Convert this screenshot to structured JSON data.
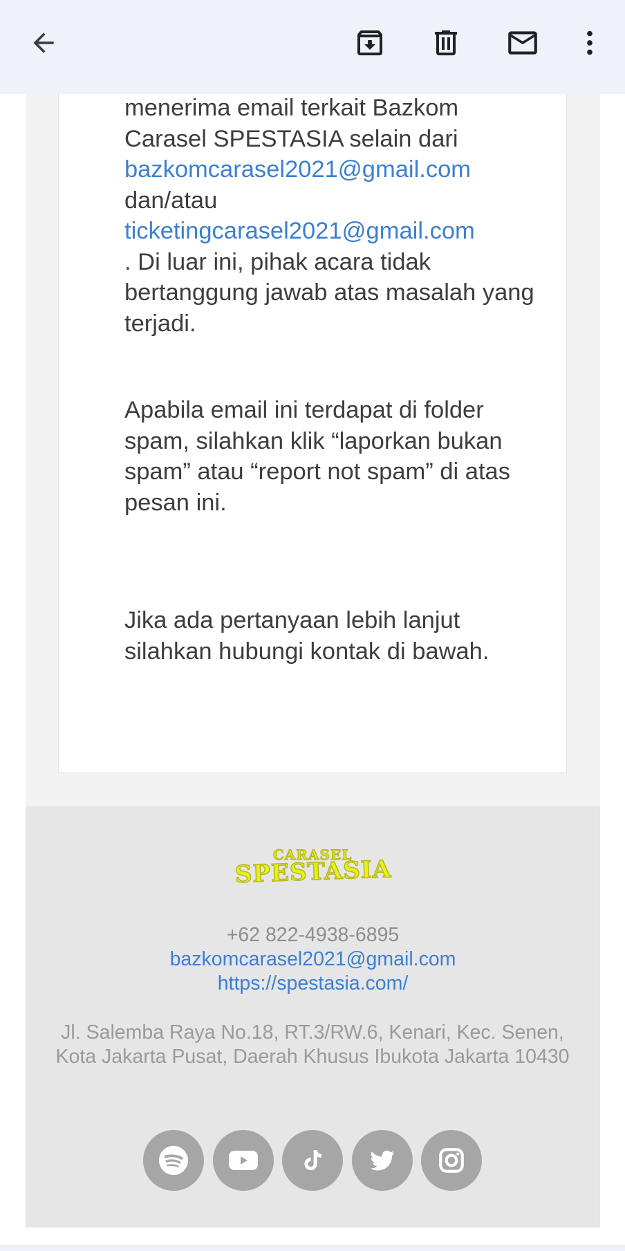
{
  "toolbar": {
    "back_icon": "arrow-left-icon",
    "archive_icon": "archive-icon",
    "delete_icon": "trash-icon",
    "mark_unread_icon": "mail-icon",
    "more_icon": "more-vertical-icon"
  },
  "email": {
    "para1": {
      "text_a": "menerima email terkait Bazkom Carasel SPESTASIA selain dari",
      "link1": "bazkomcarasel2021@gmail.com",
      "text_b": "dan/atau",
      "link2": "ticketingcarasel2021@gmail.com",
      "text_c": ". Di luar ini, pihak acara tidak bertanggung jawab atas masalah yang terjadi."
    },
    "para2": "Apabila email ini terdapat di folder spam, silahkan klik “laporkan bukan spam” atau “report not spam” di atas pesan ini.",
    "para3": "Jika ada pertanyaan lebih lanjut silahkan hubungi kontak di bawah."
  },
  "footer": {
    "logo_line1": "CARASEL",
    "logo_line2": "SPESTASIA",
    "phone": "+62 822-4938-6895",
    "email": "bazkomcarasel2021@gmail.com",
    "website": "https://spestasia.com/",
    "address": "Jl. Salemba Raya No.18, RT.3/RW.6, Kenari, Kec. Senen, Kota Jakarta Pusat, Daerah Khusus Ibukota Jakarta 10430",
    "social_icons": [
      "spotify-icon",
      "youtube-icon",
      "tiktok-icon",
      "twitter-icon",
      "instagram-icon"
    ]
  },
  "colors": {
    "appbar_bg": "#eff2f9",
    "link": "#3d7fd0",
    "body_text": "#3d3d3d",
    "footer_bg": "#e6e6e6",
    "social_bg": "#a6a6a6",
    "logo_yellow": "#e8ef1e"
  }
}
